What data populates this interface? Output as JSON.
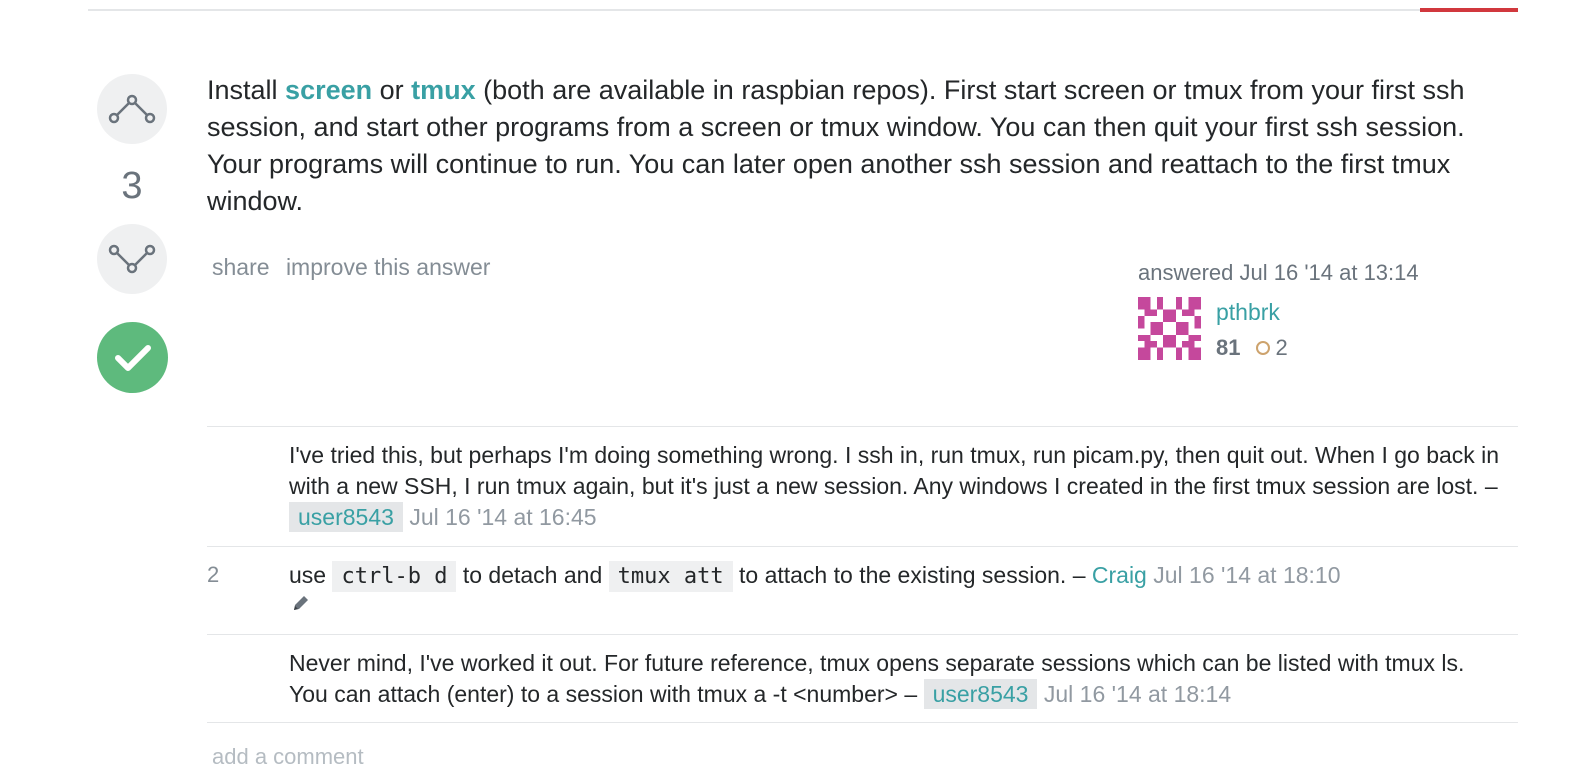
{
  "answer": {
    "vote_count": "3",
    "body_pre": "Install ",
    "link_screen": "screen",
    "body_mid1": " or ",
    "link_tmux": "tmux",
    "body_rest": " (both are available in raspbian repos). First start screen or tmux from your first ssh session, and start other programs from a screen or tmux window. You can then quit your first ssh session. Your programs will continue to run. You can later open another ssh session and reattach to the first tmux window.",
    "menu": {
      "share": "share",
      "improve": "improve this answer"
    },
    "signature": {
      "action_time": "answered Jul 16 '14 at 13:14",
      "user": "pthbrk",
      "reputation": "81",
      "bronze": "2"
    }
  },
  "colors": {
    "accent": "#39a0a4",
    "accepted": "#5eba7d",
    "tab_accent": "#d1383d"
  },
  "icons": [
    "upvote-icon",
    "downvote-icon",
    "accepted-check-icon",
    "pencil-icon",
    "bronze-badge-icon"
  ],
  "comments": [
    {
      "score": "",
      "text": "I've tried this, but perhaps I'm doing something wrong. I ssh in, run tmux, run picam.py, then quit out. When I go back in with a new SSH, I run tmux again, but it's just a new session. Any windows I created in the first tmux session are lost.",
      "sep": " – ",
      "user": "user8543",
      "date": "Jul 16 '14 at 16:45"
    },
    {
      "score": "2",
      "t1": "use ",
      "code1": "ctrl-b d",
      "t2": " to detach and ",
      "code2": "tmux att",
      "t3": " to attach to the existing session.",
      "sep": " – ",
      "user": "Craig",
      "date": "Jul 16 '14 at 18:10"
    },
    {
      "score": "",
      "text": "Never mind, I've worked it out. For future reference, tmux opens separate sessions which can be listed with tmux ls. You can attach (enter) to a session with tmux a -t <number>",
      "sep": " – ",
      "user": "user8543",
      "date": "Jul 16 '14 at 18:14"
    }
  ],
  "add_comment": "add a comment"
}
